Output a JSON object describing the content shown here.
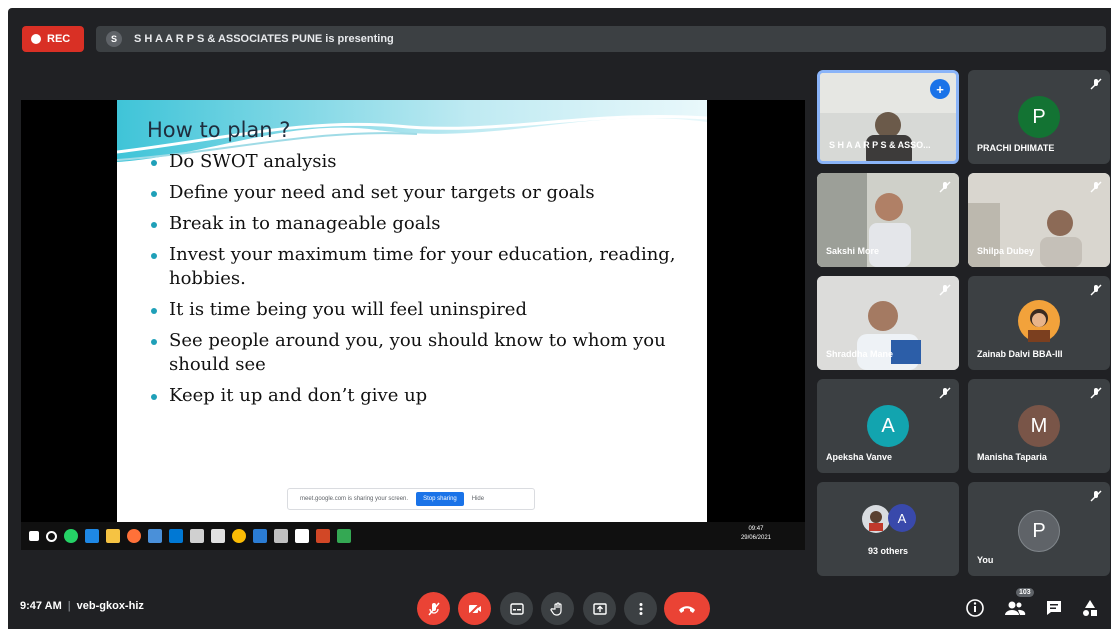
{
  "top_bar": {
    "rec_label": "REC",
    "presenting_text": "S H A A R P S & ASSOCIATES PUNE is presenting",
    "presenter_icon_letter": "S"
  },
  "slide": {
    "title": "How to plan ?",
    "bullets": [
      "Do SWOT analysis",
      "Define your need and set your targets or goals",
      "Break in to manageable goals",
      "Invest your maximum time for  your education, reading, hobbies.",
      "It is time being you will feel uninspired",
      "See people around you, you should know to whom you should see",
      "Keep it up and don’t give up"
    ],
    "share_notice_text": "meet.google.com is sharing your screen.",
    "stop_sharing_label": "Stop sharing",
    "hide_label": "Hide"
  },
  "taskbar": {
    "time": "09:47",
    "date": "29/06/2021"
  },
  "participants": [
    {
      "name": "S H A A R P S & ASSO...",
      "type": "video",
      "pinned": true
    },
    {
      "name": "PRACHI DHIMATE",
      "type": "avatar",
      "letter": "P",
      "color": "#137333"
    },
    {
      "name": "Sakshi More",
      "type": "video"
    },
    {
      "name": "Shilpa Dubey",
      "type": "video"
    },
    {
      "name": "Shraddha Mane",
      "type": "video"
    },
    {
      "name": "Zainab Dalvi BBA-III",
      "type": "avatar-image"
    },
    {
      "name": "Apeksha Vanve",
      "type": "avatar",
      "letter": "A",
      "color": "#12a4af"
    },
    {
      "name": "Manisha Taparia",
      "type": "avatar",
      "letter": "M",
      "color": "#795548"
    },
    {
      "name": "93 others",
      "type": "others",
      "letter": "A",
      "color": "#3949ab"
    },
    {
      "name": "You",
      "type": "avatar",
      "letter": "P",
      "color": "#5f6368"
    }
  ],
  "bottom_bar": {
    "time": "9:47 AM",
    "meeting_code": "veb-gkox-hiz",
    "people_count": "103"
  },
  "colors": {
    "background": "#202124",
    "tile": "#3c4043",
    "danger": "#ea4335",
    "accent": "#1a73e8"
  },
  "icons": [
    "mic-off-icon",
    "camera-off-icon",
    "captions-icon",
    "raise-hand-icon",
    "present-icon",
    "more-options-icon",
    "leave-call-icon",
    "info-icon",
    "people-icon",
    "chat-icon",
    "activities-icon"
  ]
}
